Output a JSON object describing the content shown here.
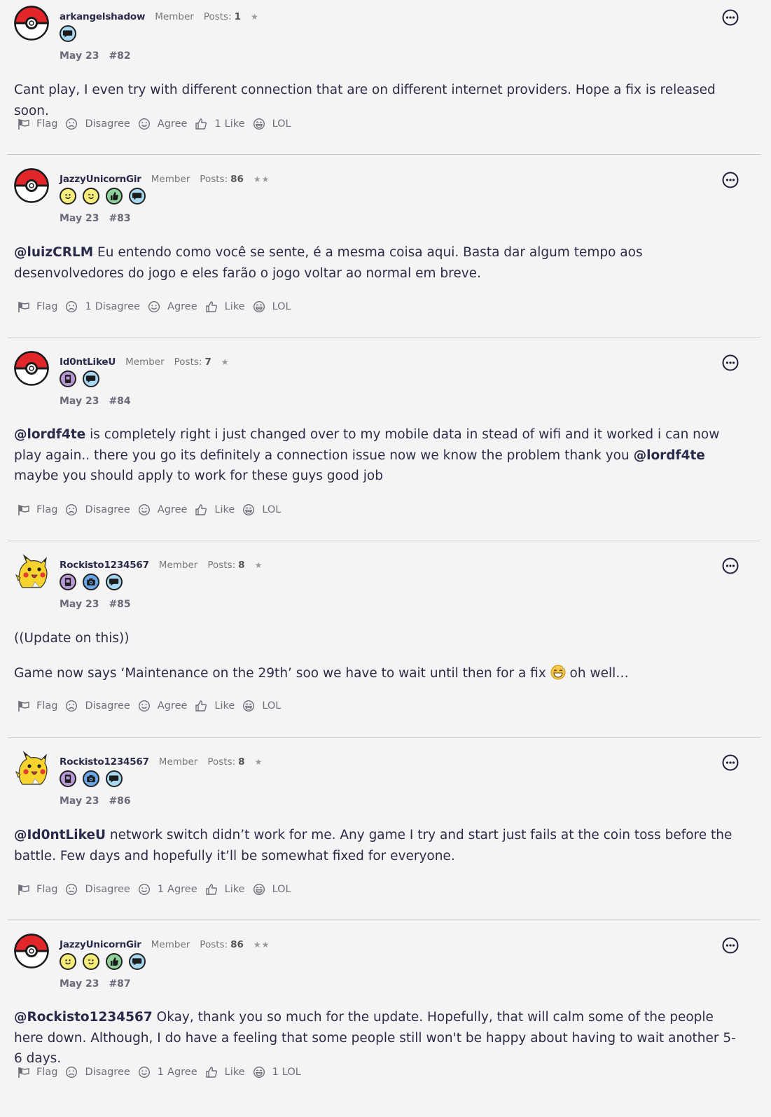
{
  "reaction_labels": {
    "flag": "Flag",
    "disagree": "Disagree",
    "agree": "Agree",
    "like": "Like",
    "lol": "LOL"
  },
  "posts": [
    {
      "username": "arkangelshadow",
      "role": "Member",
      "posts_label": "Posts:",
      "posts_count": "1",
      "stars": "★",
      "date": "May 23",
      "number": "#82",
      "avatar": "pokeball",
      "badges": [
        "comment-badge"
      ],
      "paragraphs": [
        {
          "mention": "",
          "text": "Cant play, I even try with different connection that are on different internet providers. Hope a fix is released soon."
        }
      ],
      "counts": {
        "disagree": "",
        "agree": "",
        "like": "1",
        "lol": ""
      }
    },
    {
      "username": "JazzyUnicornGir",
      "role": "Member",
      "posts_label": "Posts:",
      "posts_count": "86",
      "stars": "★★",
      "date": "May 23",
      "number": "#83",
      "avatar": "pokeball",
      "badges": [
        "smile-badge",
        "wink-badge",
        "thumbs-up-badge",
        "comment-badge"
      ],
      "paragraphs": [
        {
          "mention": "@luizCRLM",
          "text": " Eu entendo como você se sente, é a mesma coisa aqui. Basta dar algum tempo aos desenvolvedores do jogo e eles farão o jogo voltar ao normal em breve."
        }
      ],
      "counts": {
        "disagree": "1",
        "agree": "",
        "like": "",
        "lol": ""
      }
    },
    {
      "username": "Id0ntLikeU",
      "role": "Member",
      "posts_label": "Posts:",
      "posts_count": "7",
      "stars": "★",
      "date": "May 23",
      "number": "#84",
      "avatar": "pokeball",
      "badges": [
        "journal-badge",
        "comment-badge"
      ],
      "paragraphs": [
        {
          "mention": "@lordf4te",
          "text": " is completely right i just changed over to my mobile data in stead of wifi and it worked i can now play again.. there you go its definitely a connection issue now we know the problem thank you ",
          "mention2": "@lordf4te",
          "text2": " maybe you should apply to work for these guys good job"
        }
      ],
      "counts": {
        "disagree": "",
        "agree": "",
        "like": "",
        "lol": ""
      }
    },
    {
      "username": "Rockisto1234567",
      "role": "Member",
      "posts_label": "Posts:",
      "posts_count": "8",
      "stars": "★",
      "date": "May 23",
      "number": "#85",
      "avatar": "pikachu",
      "badges": [
        "journal-badge",
        "camera-badge",
        "comment-badge"
      ],
      "paragraphs": [
        {
          "mention": "",
          "text": "((Update on this))"
        },
        {
          "mention": "",
          "text": "Game now says ‘Maintenance on the 29th’ soo we have to wait until then for a fix ",
          "emoji": "sweat-smile-emoji",
          "text2b": " oh well…"
        }
      ],
      "counts": {
        "disagree": "",
        "agree": "",
        "like": "",
        "lol": ""
      }
    },
    {
      "username": "Rockisto1234567",
      "role": "Member",
      "posts_label": "Posts:",
      "posts_count": "8",
      "stars": "★",
      "date": "May 23",
      "number": "#86",
      "avatar": "pikachu",
      "badges": [
        "journal-badge",
        "camera-badge",
        "comment-badge"
      ],
      "paragraphs": [
        {
          "mention": "@Id0ntLikeU",
          "text": " network switch didn’t work for me. Any game I try and start just fails at the coin toss before the battle. Few days and hopefully it’ll be somewhat fixed for everyone."
        }
      ],
      "counts": {
        "disagree": "",
        "agree": "1",
        "like": "",
        "lol": ""
      }
    },
    {
      "username": "JazzyUnicornGir",
      "role": "Member",
      "posts_label": "Posts:",
      "posts_count": "86",
      "stars": "★★",
      "date": "May 23",
      "number": "#87",
      "avatar": "pokeball",
      "badges": [
        "smile-badge",
        "wink-badge",
        "thumbs-up-badge",
        "comment-badge"
      ],
      "paragraphs": [
        {
          "mention": "@Rockisto1234567",
          "text": " Okay, thank you so much for the update. Hopefully, that will calm some of the people here down. Although, I do have a feeling that some people still won't be happy about having to wait another 5-6 days."
        }
      ],
      "counts": {
        "disagree": "",
        "agree": "1",
        "like": "",
        "lol": "1"
      }
    }
  ]
}
